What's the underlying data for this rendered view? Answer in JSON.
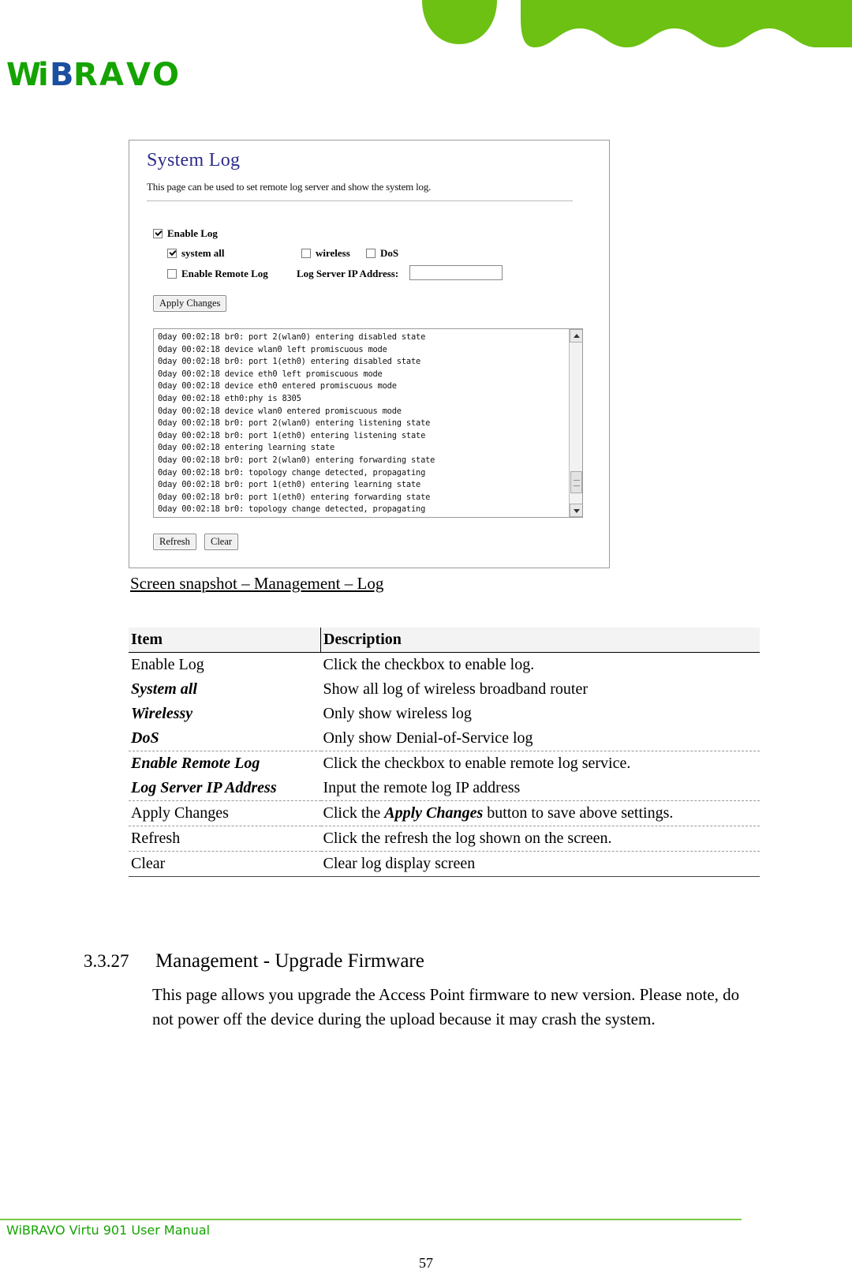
{
  "brand": {
    "logo_text_1": "Wi",
    "logo_text_2": "BRAVO"
  },
  "screenshot": {
    "title": "System Log",
    "subtitle": "This page can be used to set remote log server and show the system log.",
    "checkboxes": {
      "enable_log": "Enable Log",
      "system_all": "system all",
      "wireless": "wireless",
      "dos": "DoS",
      "enable_remote_log": "Enable Remote Log"
    },
    "ip_label": "Log Server IP Address:",
    "ip_value": "",
    "buttons": {
      "apply": "Apply Changes",
      "refresh": "Refresh",
      "clear": "Clear"
    },
    "log_lines": "0day 00:02:18 br0: port 2(wlan0) entering disabled state\n0day 00:02:18 device wlan0 left promiscuous mode\n0day 00:02:18 br0: port 1(eth0) entering disabled state\n0day 00:02:18 device eth0 left promiscuous mode\n0day 00:02:18 device eth0 entered promiscuous mode\n0day 00:02:18 eth0:phy is 8305\n0day 00:02:18 device wlan0 entered promiscuous mode\n0day 00:02:18 br0: port 2(wlan0) entering listening state\n0day 00:02:18 br0: port 1(eth0) entering listening state\n0day 00:02:18 entering learning state\n0day 00:02:18 br0: port 2(wlan0) entering forwarding state\n0day 00:02:18 br0: topology change detected, propagating\n0day 00:02:18 br0: port 1(eth0) entering learning state\n0day 00:02:18 br0: port 1(eth0) entering forwarding state\n0day 00:02:18 br0: topology change detected, propagating"
  },
  "caption": "Screen snapshot – Management – Log",
  "table": {
    "headers": {
      "item": "Item",
      "description": "Description"
    },
    "rows": [
      {
        "item": "Enable Log",
        "style": "normal",
        "desc": "Click the checkbox to enable log."
      },
      {
        "item": "System all",
        "style": "bolditalic",
        "desc": "Show all log of wireless broadband router"
      },
      {
        "item": "Wirelessy",
        "style": "bolditalic",
        "desc": "Only show wireless log"
      },
      {
        "item": "DoS",
        "style": "bolditalic",
        "desc": "Only show Denial-of-Service log"
      },
      {
        "item": "Enable Remote Log",
        "style": "bolditalic",
        "desc": "Click the checkbox to enable remote log service."
      },
      {
        "item": "Log Server IP Address",
        "style": "bolditalic",
        "desc": "Input the remote log IP address"
      },
      {
        "item": "Apply Changes",
        "style": "normal",
        "desc_pre": "Click the ",
        "desc_em": "Apply Changes",
        "desc_post": " button to save above settings."
      },
      {
        "item": "Refresh",
        "style": "normal",
        "desc": "Click the refresh the log shown on the screen."
      },
      {
        "item": "Clear",
        "style": "normal",
        "desc": "Clear log display screen"
      }
    ]
  },
  "section": {
    "number": "3.3.27",
    "title": "Management - Upgrade Firmware",
    "body": "This page allows you upgrade the Access Point firmware to new version. Please note, do not power off the device during the upload because it may crash the system."
  },
  "footer": {
    "manual": "WiBRAVO Virtu 901 User Manual",
    "page": "57"
  }
}
